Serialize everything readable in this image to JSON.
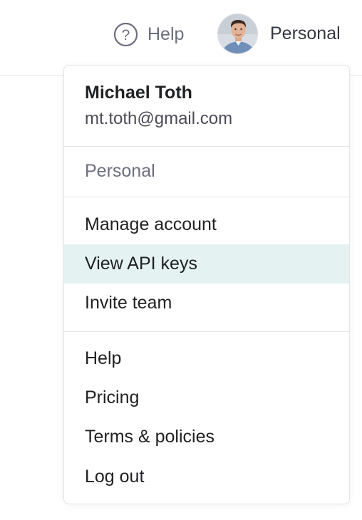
{
  "header": {
    "help_label": "Help",
    "help_icon": "question-circle-icon",
    "account_label": "Personal",
    "avatar_icon": "user-avatar"
  },
  "menu": {
    "user": {
      "name": "Michael Toth",
      "email": "mt.toth@gmail.com"
    },
    "org_label": "Personal",
    "account_items": [
      {
        "label": "Manage account"
      },
      {
        "label": "View API keys",
        "highlighted": true
      },
      {
        "label": "Invite team"
      }
    ],
    "general_items": [
      {
        "label": "Help"
      },
      {
        "label": "Pricing"
      },
      {
        "label": "Terms & policies"
      },
      {
        "label": "Log out"
      }
    ]
  },
  "colors": {
    "highlight_bg": "#e5f2f2",
    "muted_text": "#6e6e80",
    "divider": "#e5e5e7"
  }
}
